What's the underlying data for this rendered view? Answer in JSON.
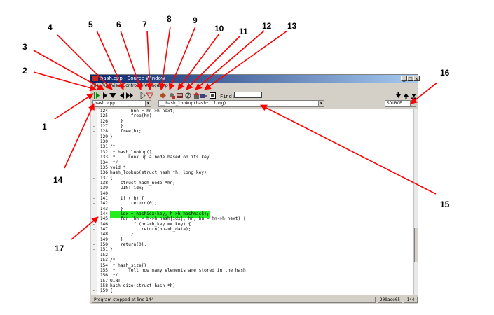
{
  "window": {
    "title": "hash.cpp - Source Window",
    "controls": [
      "_",
      "□",
      "×"
    ]
  },
  "menu": {
    "items": [
      "File",
      "Run",
      "View",
      "Control",
      "Preferences",
      "Help"
    ]
  },
  "toolbar": {
    "find_label": "Find:",
    "find_value": "",
    "icons": [
      "run-icon",
      "step-icon",
      "next-icon",
      "finish-icon",
      "continue-icon",
      "step-asm-icon",
      "next-asm-icon",
      "stop-icon",
      "up-icon",
      "down-icon",
      "breakpoints-icon",
      "memory-icon",
      "registers-icon",
      "stack-icon",
      "watch-icon",
      "locals-icon",
      "console-icon",
      "find-up-icon",
      "find-down-icon",
      "find-bottom-icon"
    ]
  },
  "combos": {
    "file": "hash.cpp",
    "function": "__hash_lookup(hash*, long)",
    "mode": "SOURCE"
  },
  "code": {
    "highlight_line": "144",
    "lines": [
      {
        "mk": "",
        "ln": "124",
        "tx": "        hnn = hn->h_next;"
      },
      {
        "mk": "",
        "ln": "125",
        "tx": "        free(hn);"
      },
      {
        "mk": "",
        "ln": "126",
        "tx": "    }"
      },
      {
        "mk": "-",
        "ln": "127",
        "tx": "    }"
      },
      {
        "mk": "-",
        "ln": "128",
        "tx": "    free(h);"
      },
      {
        "mk": "-",
        "ln": "129",
        "tx": "}"
      },
      {
        "mk": "",
        "ln": "130",
        "tx": ""
      },
      {
        "mk": "",
        "ln": "131",
        "tx": "/*"
      },
      {
        "mk": "",
        "ln": "132",
        "tx": " * hash_lookup()"
      },
      {
        "mk": "",
        "ln": "133",
        "tx": " *     Look up a node based on its key"
      },
      {
        "mk": "",
        "ln": "134",
        "tx": " */"
      },
      {
        "mk": "",
        "ln": "135",
        "tx": "void *"
      },
      {
        "mk": "",
        "ln": "136",
        "tx": "hash_lookup(struct hash *h, long key)"
      },
      {
        "mk": "-",
        "ln": "137",
        "tx": "{"
      },
      {
        "mk": "",
        "ln": "138",
        "tx": "    struct hash_node *hn;"
      },
      {
        "mk": "",
        "ln": "139",
        "tx": "    UINT idx;"
      },
      {
        "mk": "",
        "ln": "140",
        "tx": ""
      },
      {
        "mk": "-",
        "ln": "141",
        "tx": "    if (!h) {"
      },
      {
        "mk": "-",
        "ln": "142",
        "tx": "        return(0);"
      },
      {
        "mk": "",
        "ln": "143",
        "tx": "    }"
      },
      {
        "mk": "-",
        "ln": "144",
        "tx": "    idx = hashidx(key, h->h_hashmask);"
      },
      {
        "mk": "-",
        "ln": "145",
        "tx": "    for (hn = h->h_hash[idx]; hn; hn = hn->h_next) {"
      },
      {
        "mk": "-",
        "ln": "146",
        "tx": "        if (hn->h_key == key) {"
      },
      {
        "mk": "-",
        "ln": "147",
        "tx": "            return(hn->h_data);"
      },
      {
        "mk": "",
        "ln": "148",
        "tx": "        }"
      },
      {
        "mk": "",
        "ln": "149",
        "tx": "    }"
      },
      {
        "mk": "-",
        "ln": "150",
        "tx": "    return(0);"
      },
      {
        "mk": "-",
        "ln": "151",
        "tx": "}"
      },
      {
        "mk": "",
        "ln": "152",
        "tx": ""
      },
      {
        "mk": "",
        "ln": "153",
        "tx": "/*"
      },
      {
        "mk": "",
        "ln": "154",
        "tx": " * hash_size()"
      },
      {
        "mk": "",
        "ln": "155",
        "tx": " *     Tell how many elements are stored in the hash"
      },
      {
        "mk": "",
        "ln": "156",
        "tx": " */"
      },
      {
        "mk": "",
        "ln": "157",
        "tx": "UINT"
      },
      {
        "mk": "",
        "ln": "158",
        "tx": "hash_size(struct hash *h)"
      },
      {
        "mk": "-",
        "ln": "159",
        "tx": "{"
      }
    ]
  },
  "status": {
    "message": "Program stopped at line 144",
    "address": "200ace05",
    "line": "144"
  },
  "callouts": [
    "1",
    "2",
    "3",
    "4",
    "5",
    "6",
    "7",
    "8",
    "9",
    "10",
    "11",
    "12",
    "13",
    "14",
    "15",
    "16",
    "17"
  ],
  "colors": {
    "highlight": "#22ee22",
    "arrow": "#ff0000",
    "title_bar": "#0a246a"
  }
}
